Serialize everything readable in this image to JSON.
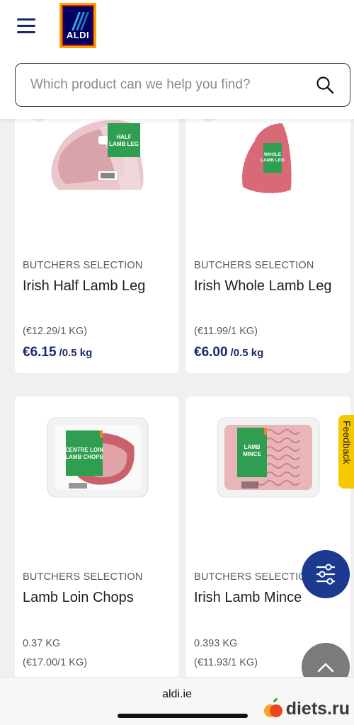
{
  "header": {
    "logo_text": "ALDI",
    "search_placeholder": "Which product can we help you find?"
  },
  "products": [
    {
      "brand": "BUTCHERS SELECTION",
      "name": "Irish Half Lamb Leg",
      "unit_price": "(€12.29/1 KG)",
      "price": "€6.15",
      "price_unit": "/0.5 kg",
      "label_lines": [
        "HALF",
        "LAMB LEG"
      ]
    },
    {
      "brand": "BUTCHERS SELECTION",
      "name": "Irish Whole Lamb Leg",
      "unit_price": "(€11.99/1 KG)",
      "price": "€6.00",
      "price_unit": "/0.5 kg",
      "label_lines": [
        "WHOLE",
        "LAMB LEG"
      ]
    },
    {
      "brand": "BUTCHERS SELECTION",
      "name": "Lamb Loin Chops",
      "weight": "0.37 KG",
      "unit_price": "(€17.00/1 KG)",
      "label_lines": [
        "CENTRE LOIN",
        "LAMB CHOPS"
      ]
    },
    {
      "brand": "BUTCHERS SELECTION",
      "name": "Irish Lamb Mince",
      "weight": "0.393 KG",
      "unit_price": "(€11.93/1 KG)",
      "label_lines": [
        "LAMB",
        "MINCE"
      ]
    }
  ],
  "feedback_label": "Feedback",
  "browser": {
    "url": "aldi.ie"
  },
  "watermark": "diets.ru",
  "colors": {
    "brand_blue": "#1c2a6b",
    "feedback_yellow": "#f7c800",
    "filter_blue": "#1c3a8f"
  }
}
